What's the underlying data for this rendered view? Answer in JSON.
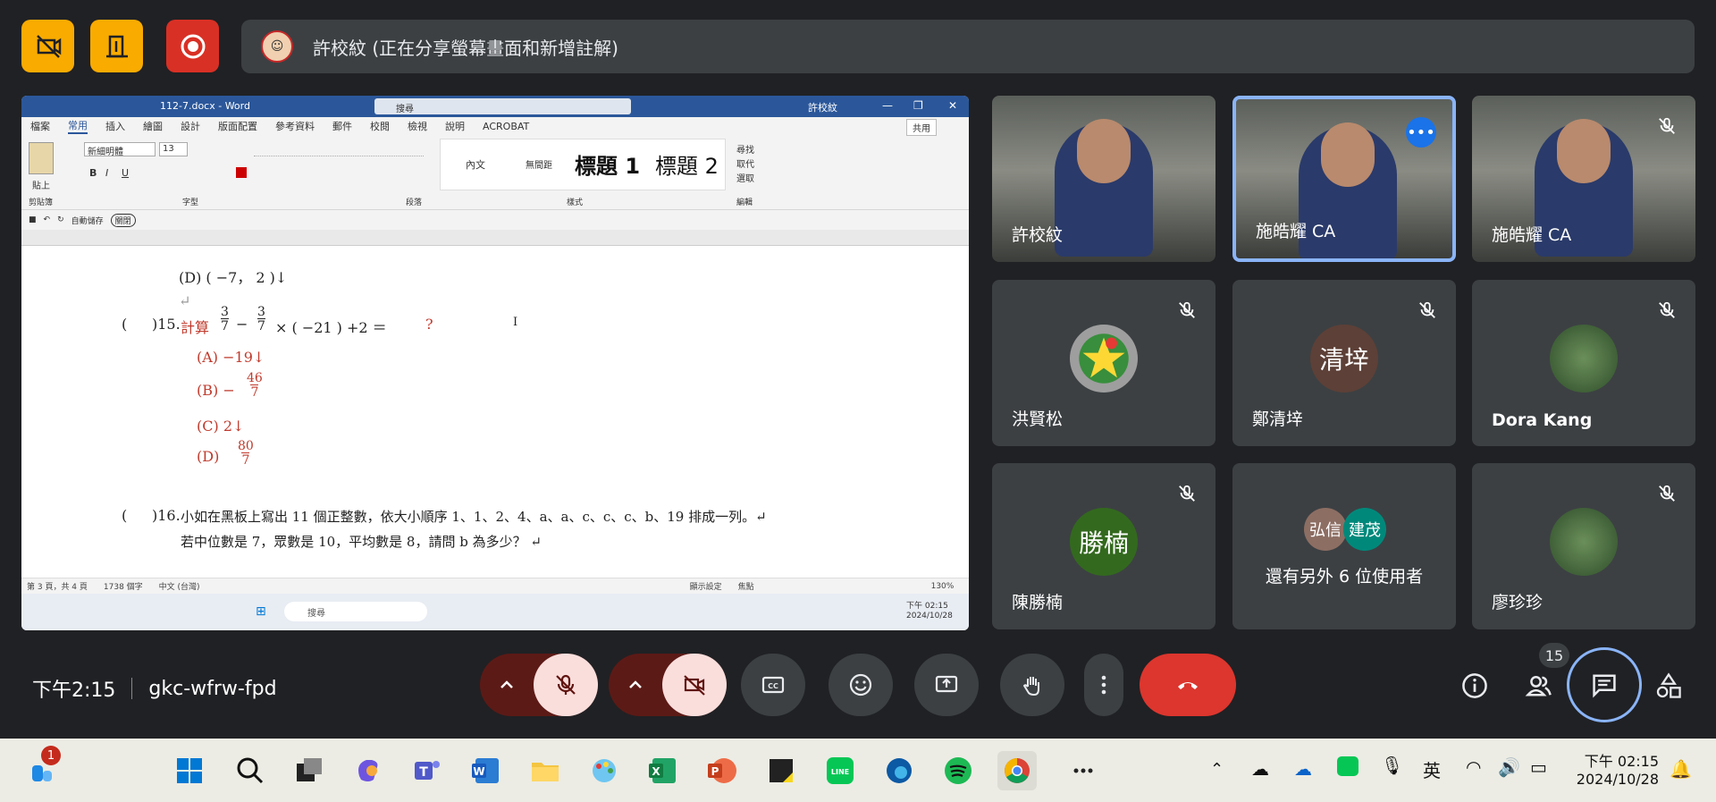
{
  "presenter_bar": {
    "text": "許校紋 (正在分享螢幕畫面和新增註解)",
    "avatar_icon": "presenter-avatar"
  },
  "top_buttons": [
    {
      "icon": "no-video-icon",
      "color": "#f9ab00"
    },
    {
      "icon": "exit-icon",
      "color": "#f9ab00"
    },
    {
      "icon": "record-icon",
      "color": "#d93025"
    }
  ],
  "word": {
    "doc_title": "112-7.docx - Word",
    "search_placeholder": "搜尋",
    "user": "許校紋",
    "tabs": [
      "檔案",
      "常用",
      "插入",
      "繪圖",
      "設計",
      "版面配置",
      "參考資料",
      "郵件",
      "校閱",
      "檢視",
      "說明",
      "ACROBAT"
    ],
    "active_tab": "常用",
    "share_label": "共用",
    "font_name": "新細明體",
    "font_size": "13",
    "paste_label": "貼上",
    "groups": [
      "剪貼簿",
      "字型",
      "段落",
      "樣式",
      "編輯"
    ],
    "styles": [
      "內文",
      "無間距",
      "標題 1",
      "標題 2"
    ],
    "edit_items": [
      "尋找",
      "取代",
      "選取"
    ],
    "autosave_label": "自動儲存",
    "autosave_state": "關閉",
    "status": {
      "page": "第 3 頁，共 4 頁",
      "words": "1738 個字",
      "lang": "中文 (台灣)",
      "display": "顯示設定",
      "focus": "焦點",
      "zoom": "130%"
    },
    "taskbar_search": "搜尋",
    "inner_time": "下午 02:15",
    "inner_date": "2024/10/28"
  },
  "document": {
    "line_d_prev": "(D)  ( −7， 2 )↓",
    "q15_paren": "(",
    "q15_num": ")15.",
    "q15_text": "計算",
    "q15_expr": "− ",
    "q15_expr2": "× ( −21 ) +2  ＝",
    "q15_q": "?",
    "frac_a_num": "3",
    "frac_a_den": "7",
    "frac_b_num": "3",
    "frac_b_den": "7",
    "opt_a": "(A)   −19↓",
    "opt_b_label": "(B)   −",
    "opt_b_num": "46",
    "opt_b_den": "7",
    "opt_c": "(C)    2↓",
    "opt_d_label": "(D)",
    "opt_d_num": "80",
    "opt_d_den": "7",
    "q16_paren": "(",
    "q16_num": ")16.",
    "q16_line1": "小如在黑板上寫出 11 個正整數，依大小順序 1、1、2、4、a、a、c、c、c、b、19 排成一列。↵",
    "q16_line2": "若中位數是 7，眾數是 10，平均數是 8，請問 b 為多少？ ↵"
  },
  "participants": [
    {
      "name": "許校紋",
      "type": "video",
      "muted": false
    },
    {
      "name": "施皓耀 CA",
      "type": "video",
      "muted": false,
      "active": true
    },
    {
      "name": "施皓耀 CA",
      "type": "video",
      "muted": true
    },
    {
      "name": "洪賢松",
      "type": "logo",
      "muted": true
    },
    {
      "name": "鄭清垶",
      "type": "avatar",
      "avatar_text": "清垶",
      "avatar_color": "#5d4037",
      "muted": true
    },
    {
      "name": "Dora Kang",
      "type": "photo",
      "muted": true
    },
    {
      "name": "陳勝楠",
      "type": "avatar",
      "avatar_text": "勝楠",
      "avatar_color": "#33691e",
      "muted": true
    },
    {
      "name": "還有另外 6 位使用者",
      "type": "group",
      "chips": [
        "弘信",
        "建茂"
      ],
      "muted": false
    },
    {
      "name": "廖珍珍",
      "type": "photo",
      "muted": true
    }
  ],
  "meeting": {
    "time": "下午2:15",
    "code": "gkc-wfrw-fpd",
    "people_count": "15"
  },
  "controls": [
    "mic-off",
    "camera-off",
    "captions",
    "emoji",
    "present",
    "raise-hand",
    "more",
    "end-call"
  ],
  "right_controls": [
    "info",
    "people",
    "chat",
    "activities"
  ],
  "taskbar": {
    "badge": "1",
    "tray_lang": "英",
    "time": "下午 02:15",
    "date": "2024/10/28"
  }
}
